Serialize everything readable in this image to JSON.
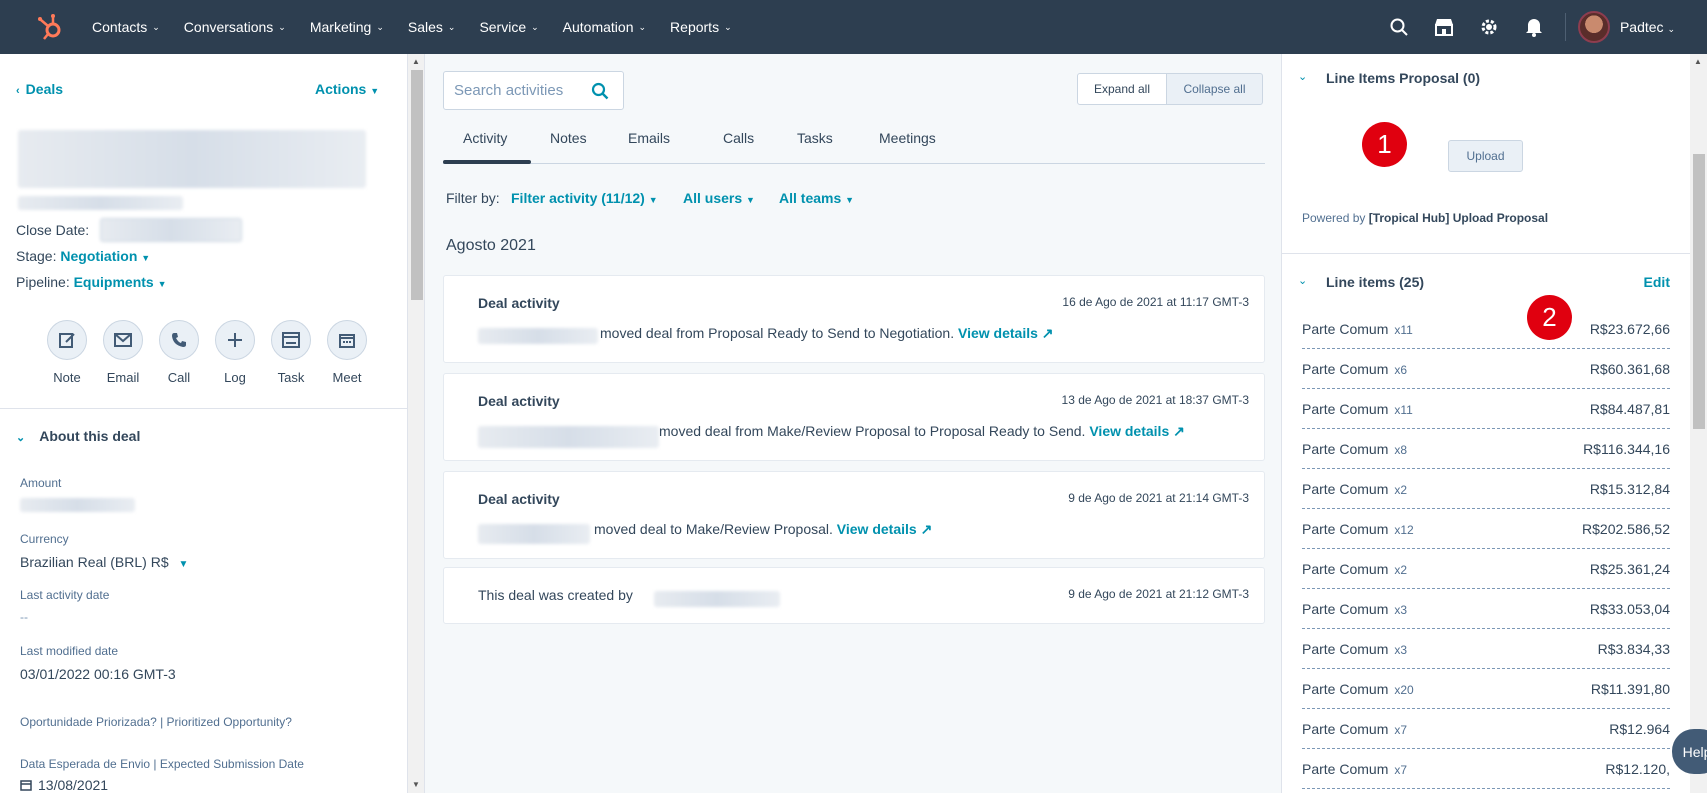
{
  "nav": {
    "items": [
      "Contacts",
      "Conversations",
      "Marketing",
      "Sales",
      "Service",
      "Automation",
      "Reports"
    ],
    "account": "Padtec"
  },
  "left": {
    "back_label": "Deals",
    "actions_label": "Actions",
    "close_date_label": "Close Date:",
    "stage_label": "Stage:",
    "stage_value": "Negotiation",
    "pipeline_label": "Pipeline:",
    "pipeline_value": "Equipments",
    "action_buttons": [
      "Note",
      "Email",
      "Call",
      "Log",
      "Task",
      "Meet"
    ],
    "about_title": "About this deal",
    "props": {
      "amount_label": "Amount",
      "currency_label": "Currency",
      "currency_value": "Brazilian Real (BRL) R$",
      "last_activity_label": "Last activity date",
      "last_activity_value": "--",
      "last_modified_label": "Last modified date",
      "last_modified_value": "03/01/2022 00:16 GMT-3",
      "prioritized_label": "Oportunidade Priorizada? | Prioritized Opportunity?",
      "expected_label": "Data Esperada de Envio | Expected Submission Date",
      "expected_value": "13/08/2021"
    }
  },
  "mid": {
    "search_placeholder": "Search activities",
    "expand_all": "Expand all",
    "collapse_all": "Collapse all",
    "tabs": [
      "Activity",
      "Notes",
      "Emails",
      "Calls",
      "Tasks",
      "Meetings"
    ],
    "filter_by": "Filter by:",
    "filter_activity": "Filter activity (11/12)",
    "all_users": "All users",
    "all_teams": "All teams",
    "month": "Agosto 2021",
    "cards": [
      {
        "title": "Deal activity",
        "date": "16 de Ago de 2021 at 11:17 GMT-3",
        "text": "moved deal from Proposal Ready to Send to Negotiation.",
        "link": "View details"
      },
      {
        "title": "Deal activity",
        "date": "13 de Ago de 2021 at 18:37 GMT-3",
        "text": "moved deal from Make/Review Proposal to Proposal Ready to Send.",
        "link": "View details"
      },
      {
        "title": "Deal activity",
        "date": "9 de Ago de 2021 at 21:14 GMT-3",
        "text": "moved deal to Make/Review Proposal.",
        "link": "View details"
      }
    ],
    "created_text": "This deal was created by",
    "created_date": "9 de Ago de 2021 at 21:12 GMT-3"
  },
  "right": {
    "proposal_title": "Line Items Proposal (0)",
    "upload_label": "Upload",
    "badge1": "1",
    "powered_prefix": "Powered by",
    "powered_name": "[Tropical Hub] Upload Proposal",
    "line_items_title": "Line items (25)",
    "edit_label": "Edit",
    "badge2": "2",
    "line_items": [
      {
        "name": "Parte Comum",
        "qty": "x11",
        "price": "R$23.672,66"
      },
      {
        "name": "Parte Comum",
        "qty": "x6",
        "price": "R$60.361,68"
      },
      {
        "name": "Parte Comum",
        "qty": "x11",
        "price": "R$84.487,81"
      },
      {
        "name": "Parte Comum",
        "qty": "x8",
        "price": "R$116.344,16"
      },
      {
        "name": "Parte Comum",
        "qty": "x2",
        "price": "R$15.312,84"
      },
      {
        "name": "Parte Comum",
        "qty": "x12",
        "price": "R$202.586,52"
      },
      {
        "name": "Parte Comum",
        "qty": "x2",
        "price": "R$25.361,24"
      },
      {
        "name": "Parte Comum",
        "qty": "x3",
        "price": "R$33.053,04"
      },
      {
        "name": "Parte Comum",
        "qty": "x3",
        "price": "R$3.834,33"
      },
      {
        "name": "Parte Comum",
        "qty": "x20",
        "price": "R$11.391,80"
      },
      {
        "name": "Parte Comum",
        "qty": "x7",
        "price": "R$12.964"
      },
      {
        "name": "Parte Comum",
        "qty": "x7",
        "price": "R$12.120,"
      }
    ],
    "help_label": "Help"
  }
}
